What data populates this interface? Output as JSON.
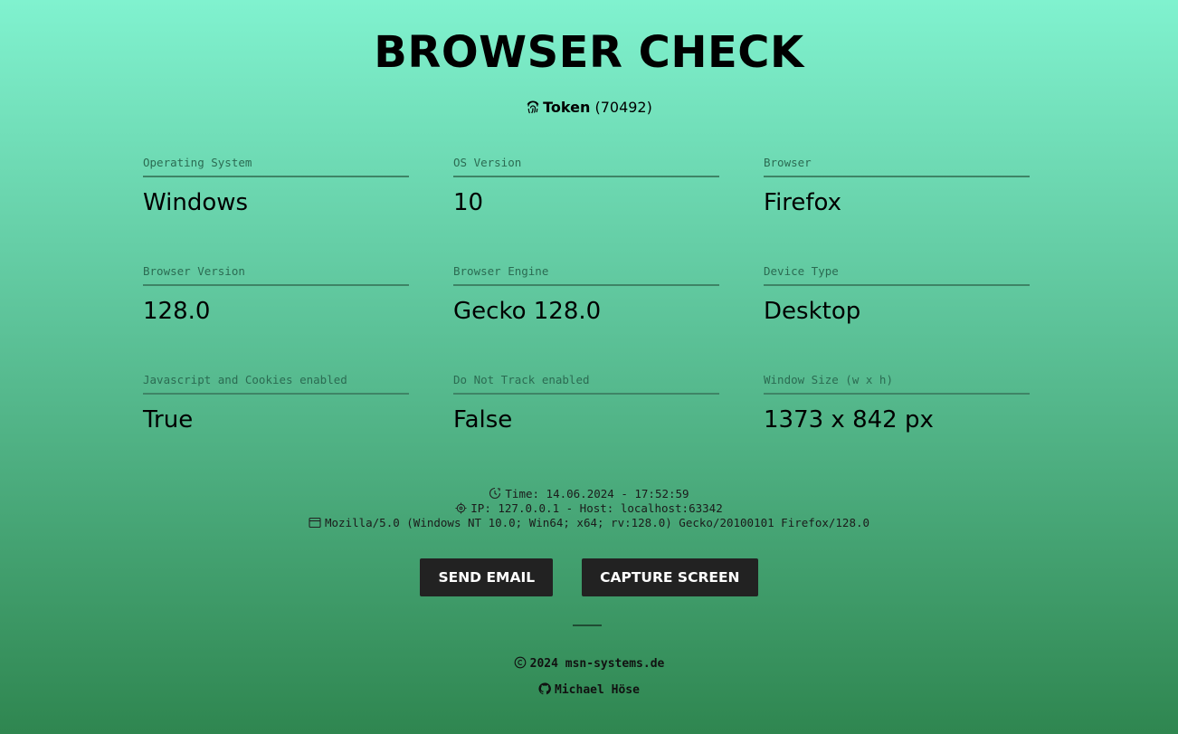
{
  "header": {
    "title": "BROWSER CHECK",
    "token_icon": "fingerprint-icon",
    "token_label": "Token",
    "token_value": "(70492)"
  },
  "fields": [
    {
      "label": "Operating System",
      "value": "Windows"
    },
    {
      "label": "OS Version",
      "value": "10"
    },
    {
      "label": "Browser",
      "value": "Firefox"
    },
    {
      "label": "Browser Version",
      "value": "128.0"
    },
    {
      "label": "Browser Engine",
      "value": "Gecko 128.0"
    },
    {
      "label": "Device Type",
      "value": "Desktop"
    },
    {
      "label": "Javascript and Cookies enabled",
      "value": "True"
    },
    {
      "label": "Do Not Track enabled",
      "value": "False"
    },
    {
      "label": "Window Size (w x h)",
      "value": "1373 x 842 px"
    }
  ],
  "meta": {
    "time": "Time: 14.06.2024 - 17:52:59",
    "network": "IP: 127.0.0.1 - Host: localhost:63342",
    "user_agent": "Mozilla/5.0 (Windows NT 10.0; Win64; x64; rv:128.0) Gecko/20100101 Firefox/128.0"
  },
  "buttons": {
    "send_email": "SEND EMAIL",
    "capture_screen": "CAPTURE SCREEN"
  },
  "footer": {
    "copyright": "2024 msn-systems.de",
    "author": "Michael Höse"
  },
  "colors": {
    "gradient_top": "#80f2cf",
    "gradient_bottom": "#2f8650",
    "button_bg": "#222222",
    "label_color": "#2b6b52"
  }
}
